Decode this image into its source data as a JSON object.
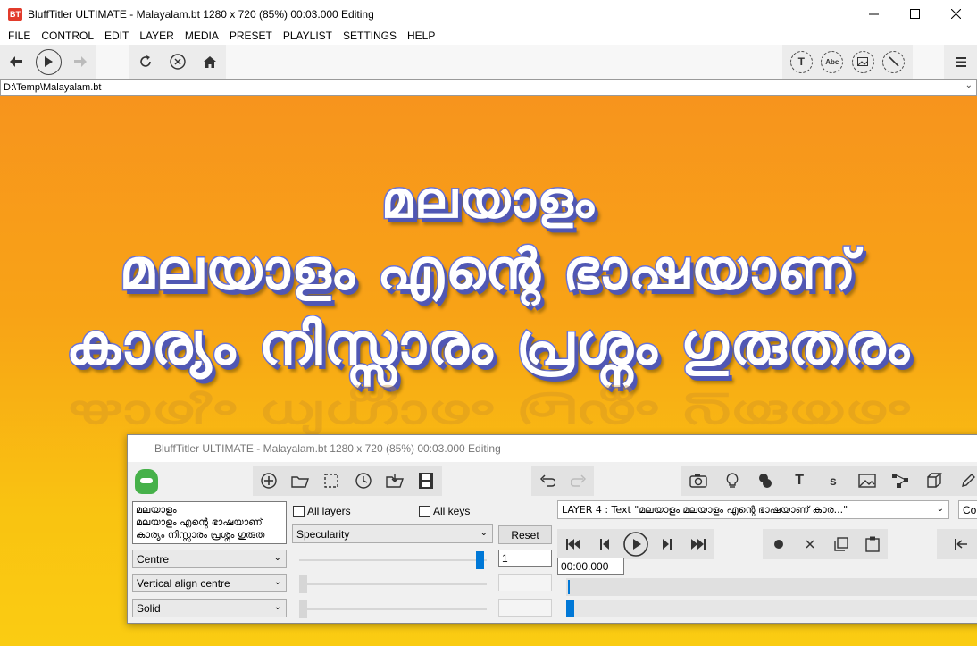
{
  "window": {
    "logo": "BT",
    "title": "BluffTitler ULTIMATE  - Malayalam.bt 1280 x 720 (85%) 00:03.000 Editing"
  },
  "menu": [
    "FILE",
    "CONTROL",
    "EDIT",
    "LAYER",
    "MEDIA",
    "PRESET",
    "PLAYLIST",
    "SETTINGS",
    "HELP"
  ],
  "toolbar": {
    "title_icon_label": "T",
    "abc_icon_label": "Abc"
  },
  "path": "D:\\Temp\\Malayalam.bt",
  "preview": {
    "line1": "മലയാളം",
    "line2": "മലയാളം എന്റെ ഭാഷയാണ്",
    "line3": "കാര്യം നിസ്സാരം പ്രശ്നം ഗുരുതരം",
    "reflection": "കാര്യം നിസ്സാരം പ്രശ്നം ഗുരുതരം"
  },
  "panel": {
    "title": "BluffTitler ULTIMATE  - Malayalam.bt 1280 x 720 (85%) 00:03.000 Editing",
    "text_lines": [
      "മലയാളം",
      "മലയാളം എന്റെ ഭാഷയാണ്",
      "കാര്യം നിസ്സാരം പ്രശ്നം ഗുരുത"
    ],
    "all_layers": "All layers",
    "all_keys": "All keys",
    "property": "Specularity",
    "reset": "Reset",
    "align": "Centre",
    "value": "1",
    "valign": "Vertical align centre",
    "fill": "Solid",
    "layer": "LAYER 4  : Text \"മലയാളം മലയാളം എന്റെ ഭാഷയാണ് കാര...\"",
    "combo_cut": "Cor",
    "time": "00:00.000",
    "p_t": "T",
    "p_s": "s"
  },
  "colors": {
    "accent": "#0078d7",
    "text_fill": "#ffffff",
    "text_outline": "#6a74d8",
    "bg_top": "#f7941d",
    "bg_bottom": "#facc12"
  }
}
